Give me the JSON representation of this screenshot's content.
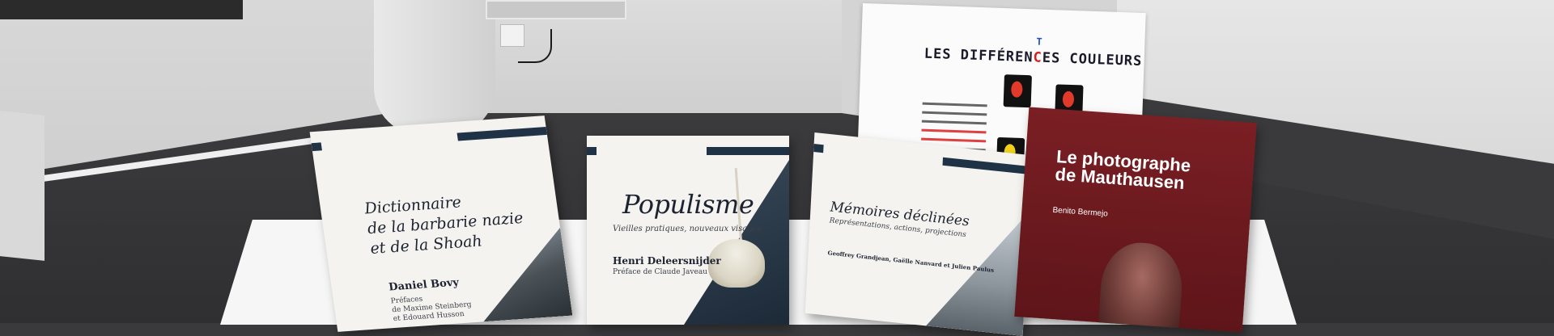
{
  "poster": {
    "title_main": "LES DIFFÉREN",
    "title_e": "C",
    "title_tail": "ES COULEURS",
    "title_insert": "T"
  },
  "books": [
    {
      "title_line1": "Dictionnaire",
      "title_line2": "de la barbarie nazie",
      "title_line3": "et de la Shoah",
      "author": "Daniel Bovy",
      "preface_line1": "Préfaces",
      "preface_line2": "de Maxime Steinberg",
      "preface_line3": "et Edouard Husson"
    },
    {
      "title": "Populisme",
      "subtitle": "Vieilles pratiques, nouveaux visages",
      "author": "Henri Deleersnijder",
      "preface": "Préface de Claude Javeau"
    },
    {
      "title": "Mémoires déclinées",
      "subtitle": "Représentations, actions, projections",
      "authors": "Geoffrey Grandjean, Gaëlle Nanvard et Julien Paulus"
    },
    {
      "title_line1": "Le photographe",
      "title_line2": "de Mauthausen",
      "author": "Benito Bermejo"
    }
  ]
}
